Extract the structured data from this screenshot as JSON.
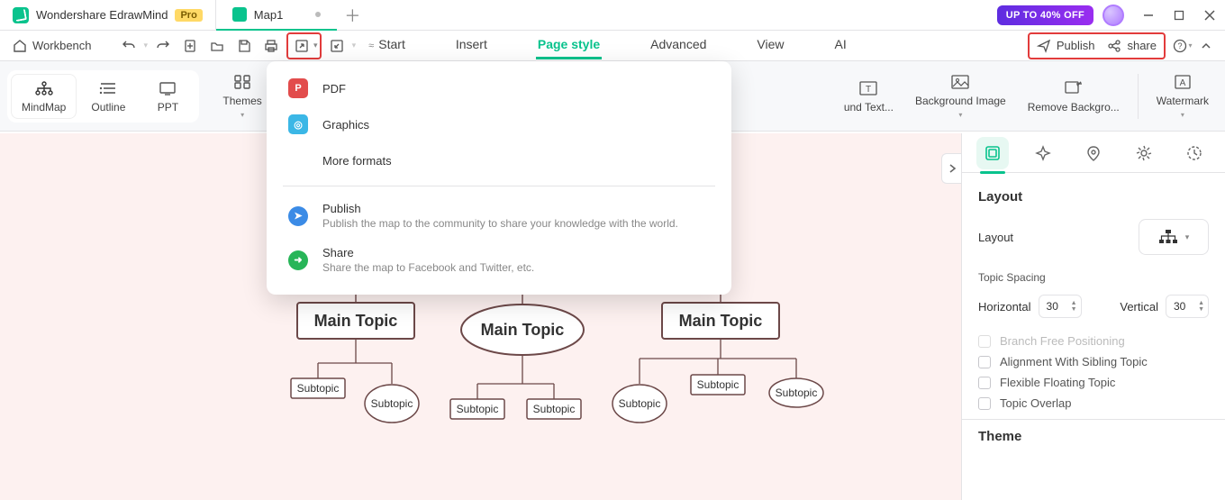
{
  "title_bar": {
    "app_name": "Wondershare EdrawMind",
    "pro_badge": "Pro",
    "doc_tab": "Map1",
    "promo": "UP TO 40% OFF"
  },
  "quickbar": {
    "workbench": "Workbench",
    "publish": "Publish",
    "share": "share"
  },
  "menus": {
    "start": "Start",
    "insert": "Insert",
    "page_style": "Page style",
    "advanced": "Advanced",
    "view": "View",
    "ai": "AI"
  },
  "ribbon": {
    "mindmap": "MindMap",
    "outline": "Outline",
    "ppt": "PPT",
    "themes": "Themes",
    "bgtext": "und Text...",
    "bgimage": "Background Image",
    "removebg": "Remove Backgro...",
    "watermark": "Watermark"
  },
  "export_menu": {
    "pdf": "PDF",
    "graphics": "Graphics",
    "more": "More formats",
    "publish_t": "Publish",
    "publish_s": "Publish the map to the community to share your knowledge with the world.",
    "share_t": "Share",
    "share_s": "Share the map to Facebook and Twitter, etc."
  },
  "mindmap": {
    "main1": "Main Topic",
    "main2": "Main Topic",
    "main3": "Main Topic",
    "sub": "Subtopic"
  },
  "side": {
    "layout": "Layout",
    "layout_label": "Layout",
    "topic_spacing": "Topic Spacing",
    "horizontal": "Horizontal",
    "vertical": "Vertical",
    "h_val": "30",
    "v_val": "30",
    "branch_free": "Branch Free Positioning",
    "align_sibling": "Alignment With Sibling Topic",
    "flex_float": "Flexible Floating Topic",
    "topic_overlap": "Topic Overlap",
    "theme": "Theme"
  }
}
